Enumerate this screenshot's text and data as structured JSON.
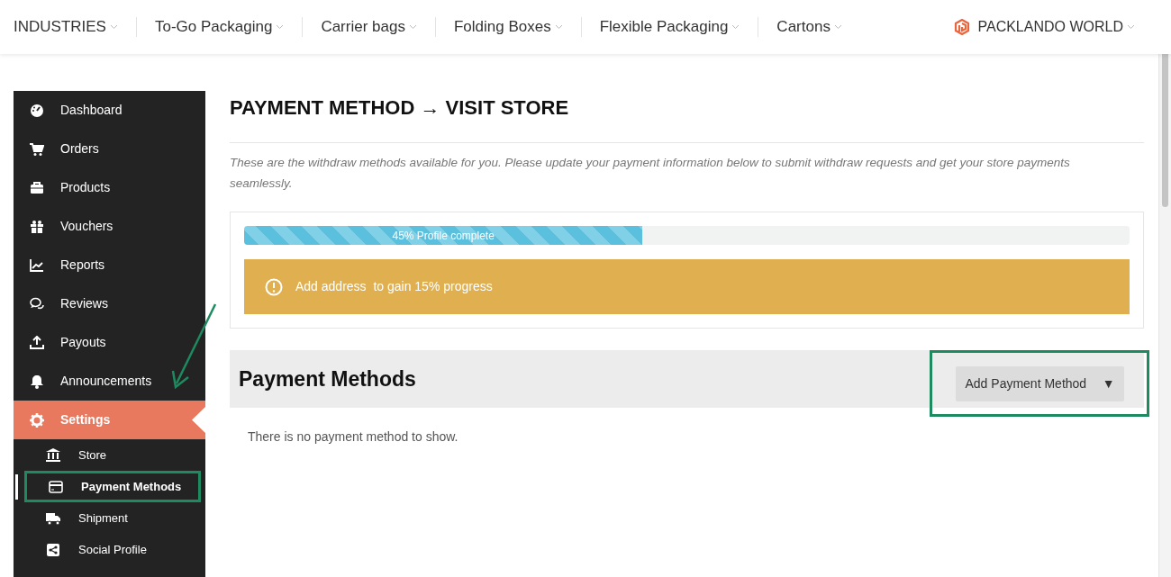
{
  "top_nav": {
    "items": [
      {
        "label": "INDUSTRIES"
      },
      {
        "label": "To-Go Packaging"
      },
      {
        "label": "Carrier bags"
      },
      {
        "label": "Folding Boxes"
      },
      {
        "label": "Flexible Packaging"
      },
      {
        "label": "Cartons"
      }
    ],
    "brand": {
      "label": "PACKLANDO WORLD"
    }
  },
  "sidebar": {
    "items": [
      {
        "label": "Dashboard",
        "selected": false
      },
      {
        "label": "Orders",
        "selected": false
      },
      {
        "label": "Products",
        "selected": false
      },
      {
        "label": "Vouchers",
        "selected": false
      },
      {
        "label": "Reports",
        "selected": false
      },
      {
        "label": "Reviews",
        "selected": false
      },
      {
        "label": "Payouts",
        "selected": false
      },
      {
        "label": "Announcements",
        "selected": false
      },
      {
        "label": "Settings",
        "selected": true,
        "children": [
          {
            "label": "Store",
            "selected": false,
            "highlighted": false
          },
          {
            "label": "Payment Methods",
            "selected": true,
            "highlighted": true
          },
          {
            "label": "Shipment",
            "selected": false,
            "highlighted": false
          },
          {
            "label": "Social Profile",
            "selected": false,
            "highlighted": false
          }
        ]
      }
    ]
  },
  "content": {
    "title": "PAYMENT METHOD → VISIT STORE",
    "intro": "These are the withdraw methods available for you. Please update your payment information below to submit withdraw requests and get your store payments seamlessly.",
    "profile_progress": {
      "level": 0.45,
      "label": "45% Profile complete",
      "notice": "Add address  to gain 15% progress"
    },
    "payment_methods": {
      "heading": "Payment Methods",
      "add_button": {
        "label": "Add Payment Method",
        "caret": "▼",
        "highlighted": true
      },
      "empty_message": "There is no payment method to show."
    }
  }
}
